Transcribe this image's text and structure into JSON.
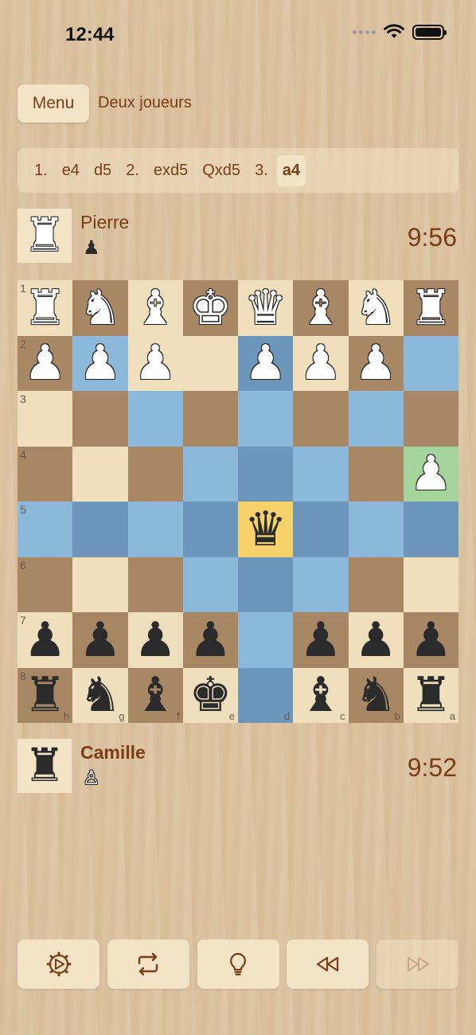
{
  "status": {
    "time": "12:44"
  },
  "header": {
    "menu_label": "Menu",
    "mode": "Deux joueurs"
  },
  "moves": [
    "1.",
    "e4",
    "d5",
    "2.",
    "exd5",
    "Qxd5",
    "3.",
    "a4"
  ],
  "current_move_index": 7,
  "player_top": {
    "name": "Pierre",
    "avatar_piece": "♜",
    "captured": "♟",
    "time": "9:56"
  },
  "player_bottom": {
    "name": "Camille",
    "avatar_piece": "♜",
    "captured": "♙",
    "time": "9:52"
  },
  "board": {
    "rank_labels": [
      "1",
      "2",
      "3",
      "4",
      "5",
      "6",
      "7",
      "8"
    ],
    "file_labels": [
      "h",
      "g",
      "f",
      "e",
      "d",
      "c",
      "b",
      "a"
    ],
    "rows": [
      [
        "wR",
        "wN",
        "wB",
        "wK",
        "wQ",
        "wB",
        "wN",
        "wR"
      ],
      [
        "wP",
        "wP",
        "wP",
        "",
        "wP",
        "wP",
        "wP",
        ""
      ],
      [
        "",
        "",
        "",
        "",
        "",
        "",
        "",
        ""
      ],
      [
        "",
        "",
        "",
        "",
        "",
        "",
        "",
        "wP"
      ],
      [
        "",
        "",
        "",
        "",
        "bQ",
        "",
        "",
        ""
      ],
      [
        "",
        "",
        "",
        "",
        "",
        "",
        "",
        ""
      ],
      [
        "bP",
        "bP",
        "bP",
        "bP",
        "",
        "bP",
        "bP",
        "bP"
      ],
      [
        "bR",
        "bN",
        "bB",
        "bK",
        "",
        "bB",
        "bN",
        "bR"
      ]
    ],
    "colors": [
      [
        "L",
        "D",
        "L",
        "D",
        "L",
        "D",
        "L",
        "D"
      ],
      [
        "D",
        "HL",
        "L",
        "L",
        "HD",
        "L",
        "D",
        "HL"
      ],
      [
        "L",
        "D",
        "HL",
        "D",
        "HL",
        "D",
        "HL",
        "D"
      ],
      [
        "D",
        "L",
        "D",
        "HL",
        "HD",
        "HL",
        "D",
        "G"
      ],
      [
        "HL",
        "HD",
        "HL",
        "HD",
        "S",
        "HD",
        "HL",
        "HD"
      ],
      [
        "D",
        "L",
        "D",
        "HL",
        "HD",
        "HL",
        "D",
        "L"
      ],
      [
        "L",
        "D",
        "L",
        "D",
        "HL",
        "D",
        "L",
        "D"
      ],
      [
        "D",
        "L",
        "D",
        "L",
        "HD",
        "L",
        "D",
        "L"
      ]
    ],
    "palette": {
      "L": "#efdfbd",
      "D": "#a88864",
      "HL": "#8cb8da",
      "HD": "#6d97ba",
      "G": "#a4d49b",
      "S": "#f7d26a"
    }
  },
  "toolbar": [
    {
      "name": "settings-button",
      "icon": "settings-icon",
      "enabled": true
    },
    {
      "name": "flip-board-button",
      "icon": "flip-icon",
      "enabled": true
    },
    {
      "name": "hint-button",
      "icon": "lightbulb-icon",
      "enabled": true
    },
    {
      "name": "rewind-button",
      "icon": "rewind-icon",
      "enabled": true
    },
    {
      "name": "forward-button",
      "icon": "forward-icon",
      "enabled": false
    }
  ],
  "colors": {
    "accent": "#7a3e16",
    "button_bg": "#f3e4c8"
  }
}
